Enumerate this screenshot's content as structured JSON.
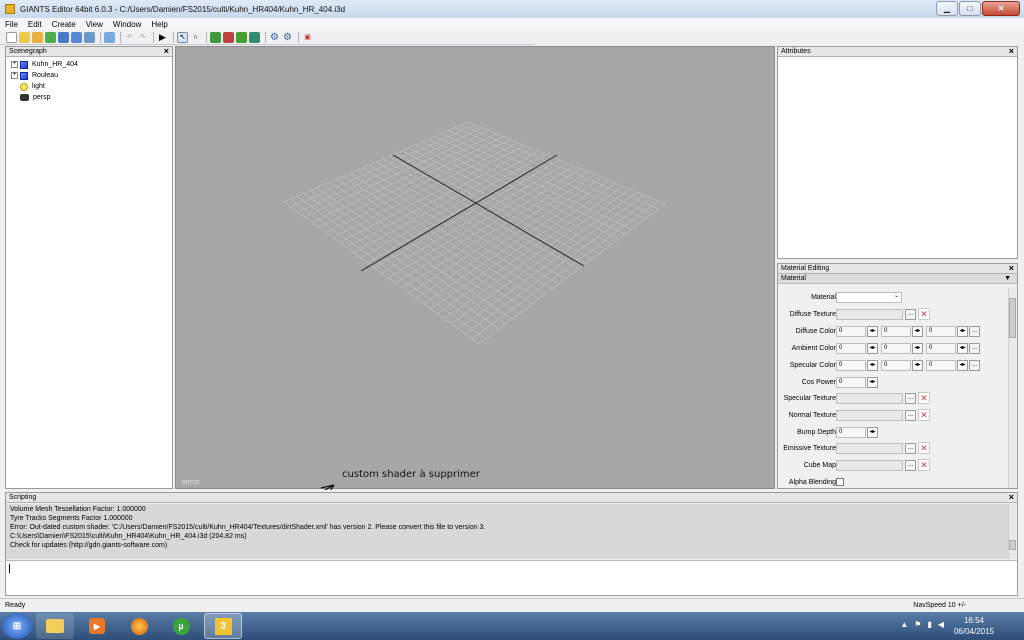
{
  "window": {
    "title": "GIANTS Editor 64bit 6.0.3 - C:/Users/Damien/FS2015/culti/Kuhn_HR404/Kuhn_HR_404.i3d"
  },
  "menu": [
    "File",
    "Edit",
    "Create",
    "View",
    "Window",
    "Help"
  ],
  "scenegraph": {
    "title": "Scenegraph",
    "items": [
      {
        "label": "Kuhn_HR_404",
        "icon": "cube-icon"
      },
      {
        "label": "Rouleau",
        "icon": "cube-icon"
      },
      {
        "label": "light",
        "icon": "light-icon"
      },
      {
        "label": "persp",
        "icon": "camera-icon"
      }
    ]
  },
  "viewport": {
    "camera_label": "persp",
    "annotation": "custom shader à supprimer"
  },
  "attributes": {
    "title": "Attributes"
  },
  "material_editing": {
    "title": "Material Editing",
    "subheader": "Material",
    "rows": [
      {
        "label": "Material",
        "type": "dropdown"
      },
      {
        "label": "Diffuse Texture",
        "type": "texture"
      },
      {
        "label": "Diffuse Color",
        "type": "color",
        "values": [
          "0",
          "0",
          "0"
        ]
      },
      {
        "label": "Ambient Color",
        "type": "color",
        "values": [
          "0",
          "0",
          "0"
        ]
      },
      {
        "label": "Specular Color",
        "type": "color",
        "values": [
          "0",
          "0",
          "0"
        ]
      },
      {
        "label": "Cos Power",
        "type": "single",
        "values": [
          "0"
        ]
      },
      {
        "label": "Specular Texture",
        "type": "texture"
      },
      {
        "label": "Normal Texture",
        "type": "texture"
      },
      {
        "label": "Bump Depth",
        "type": "single",
        "values": [
          "0"
        ]
      },
      {
        "label": "Emissive Texture",
        "type": "texture"
      },
      {
        "label": "Cube Map",
        "type": "texture"
      },
      {
        "label": "Alpha Blending",
        "type": "checkbox"
      }
    ]
  },
  "scripting": {
    "title": "Scripting",
    "lines": [
      "  Volume Mesh Tessellation Factor: 1.000000",
      "  Tyre Tracks Segments Factor 1.000000",
      "Error: Out-dated custom shader. 'C:/Users/Damien/FS2015/culti/Kuhn_HR404/Textures/dirtShader.xml' has version 2. Please convert this file to version 3.",
      "C:\\Users\\Damien\\FS2015\\culti\\Kuhn_HR404\\Kuhn_HR_404.i3d (204.82 ms)",
      "Check for updates (http://gdn.giants-software.com)"
    ]
  },
  "status": {
    "left": "Ready",
    "right": "NavSpeed 10 +/-"
  },
  "taskbar": {
    "time": "16:54",
    "date": "06/04/2015"
  },
  "colors": {
    "viewport_bg": "#a7a7a7",
    "grid": "#bdbdbd",
    "error_x": "#e04040"
  }
}
